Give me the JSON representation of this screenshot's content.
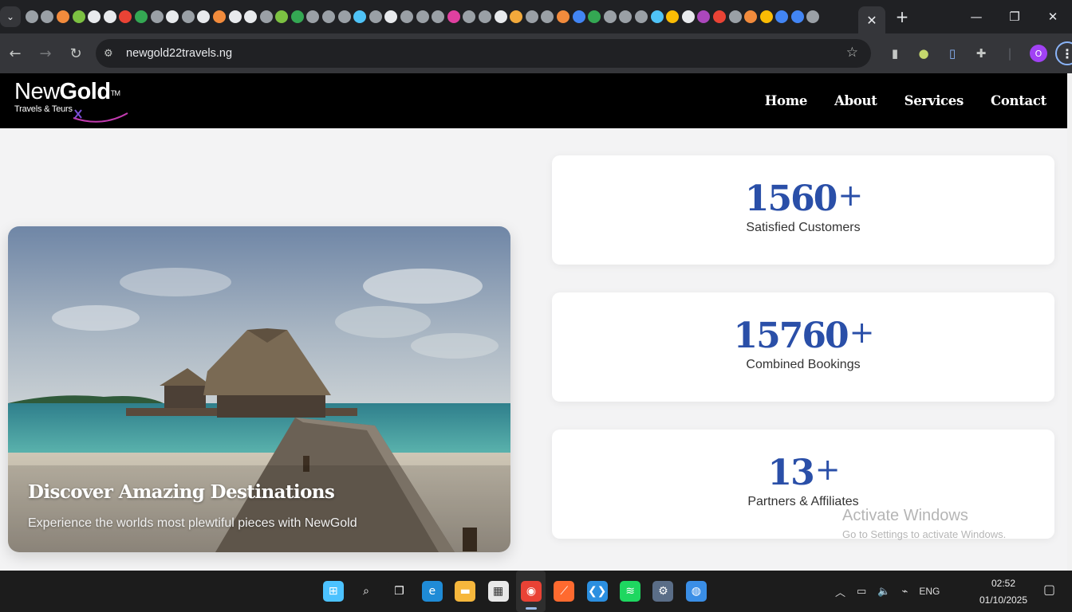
{
  "browser": {
    "url": "newgold22travels.ng",
    "profile_initial": "O",
    "active_tab_close": "✕",
    "new_tab": "+",
    "favicon_colors": [
      "#9aa0a6",
      "#9aa0a6",
      "#f28b3c",
      "#7cc142",
      "#e8eaed",
      "#e8eaed",
      "#ea4335",
      "#34a853",
      "#9aa0a6",
      "#e8eaed",
      "#9aa0a6",
      "#e8eaed",
      "#f28b3c",
      "#e8eaed",
      "#e8eaed",
      "#9aa0a6",
      "#7cc142",
      "#34a853",
      "#9aa0a6",
      "#9aa0a6",
      "#9aa0a6",
      "#4fc3f7",
      "#9aa0a6",
      "#e8eaed",
      "#9aa0a6",
      "#9aa0a6",
      "#9aa0a6",
      "#e040a0",
      "#9aa0a6",
      "#9aa0a6",
      "#e8eaed",
      "#f2a93b",
      "#9aa0a6",
      "#9aa0a6",
      "#f28b3c",
      "#4285f4",
      "#34a853",
      "#9aa0a6",
      "#9aa0a6",
      "#9aa0a6",
      "#4fc3f7",
      "#fbbc04",
      "#e8eaed",
      "#ab47bc",
      "#ea4335",
      "#9aa0a6",
      "#f28b3c",
      "#fbbc04",
      "#4285f4",
      "#4285f4",
      "#9aa0a6"
    ]
  },
  "header": {
    "logo": {
      "brand_light": "New",
      "brand_bold": "Gold",
      "tm": "TM",
      "tagline": "Travels & Teurs"
    },
    "nav": [
      "Home",
      "About",
      "Services",
      "Contact"
    ]
  },
  "hero": {
    "title": "Discover Amazing Destinations",
    "subtitle": "Experience the worlds most plewtiful pieces with NewGold"
  },
  "stats": [
    {
      "number": "1560",
      "suffix": "+",
      "label": "Satisfied Customers"
    },
    {
      "number": "15760",
      "suffix": "+",
      "label": "Combined Bookings"
    },
    {
      "number": "13",
      "suffix": "+",
      "label": "Partners & Affiliates"
    }
  ],
  "watermark": {
    "line1": "Activate Windows",
    "line2": "Go to Settings to activate Windows."
  },
  "taskbar": {
    "language": "ENG",
    "time": "02:52",
    "date": "01/10/2025",
    "apps": [
      {
        "name": "start",
        "color": "#4cc2ff"
      },
      {
        "name": "search",
        "color": "#1c1c1c"
      },
      {
        "name": "task-view",
        "color": "#1c1c1c"
      },
      {
        "name": "edge",
        "color": "#1f8bd6"
      },
      {
        "name": "file-explorer",
        "color": "#f6b73c"
      },
      {
        "name": "store",
        "color": "#e8e8e8"
      },
      {
        "name": "chrome",
        "color": "#e94235"
      },
      {
        "name": "brave",
        "color": "#ff6a2f"
      },
      {
        "name": "vscode",
        "color": "#2b8fe0"
      },
      {
        "name": "spotify",
        "color": "#1ed760"
      },
      {
        "name": "settings",
        "color": "#5a6d87"
      },
      {
        "name": "globe-app",
        "color": "#3a8ee6"
      }
    ]
  }
}
